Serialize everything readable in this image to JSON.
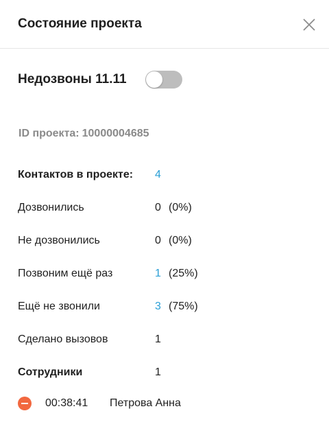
{
  "header": {
    "title": "Состояние проекта",
    "close_icon": "close-icon"
  },
  "toggle": {
    "label": "Недозвоны 11.11",
    "state": "off",
    "off_color": "#bdbdbd"
  },
  "project": {
    "id_label": "ID проекта:",
    "id_value": "10000004685"
  },
  "stats": {
    "contacts": {
      "label": "Контактов в проекте:",
      "value": "4"
    },
    "reached": {
      "label": "Дозвонились",
      "value": "0",
      "percent": "(0%)"
    },
    "not_reached": {
      "label": "Не дозвонились",
      "value": "0",
      "percent": "(0%)"
    },
    "call_again": {
      "label": "Позвоним ещё раз",
      "value": "1",
      "percent": "(25%)"
    },
    "not_called": {
      "label": "Ещё не звонили",
      "value": "3",
      "percent": "(75%)"
    },
    "calls_made": {
      "label": "Сделано вызовов",
      "value": "1"
    },
    "employees": {
      "label": "Сотрудники",
      "value": "1"
    }
  },
  "employees": [
    {
      "time": "00:38:41",
      "name": "Петрова Анна",
      "icon": "remove-icon"
    }
  ],
  "colors": {
    "accent": "#2a9fd6",
    "remove": "#f2683f",
    "muted": "#8a8a8a"
  }
}
